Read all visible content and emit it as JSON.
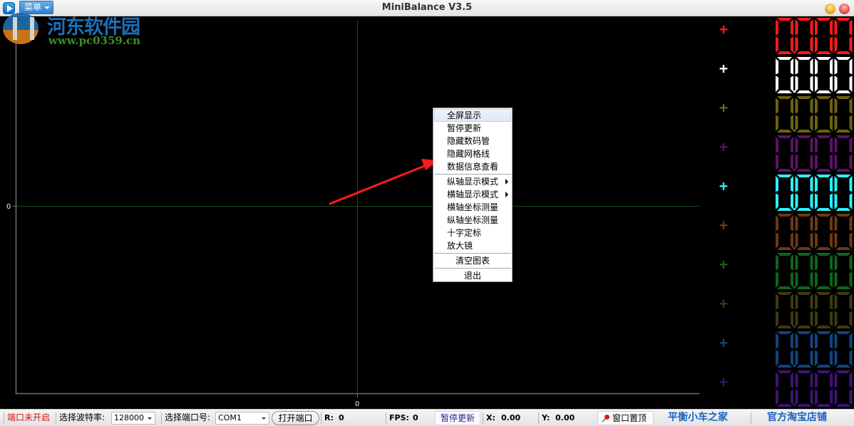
{
  "window": {
    "title": "MiniBalance V3.5",
    "menu_label": "菜单",
    "icons": {
      "app": "play-icon",
      "minimize": "minimize-icon",
      "close": "close-icon"
    }
  },
  "watermark": {
    "name": "河东软件园",
    "url": "www.pc0359.cn"
  },
  "plot": {
    "y_tick_label": "0",
    "x_tick_label": "0",
    "colors": {
      "background": "#000000",
      "axis": "#707070",
      "gridline": "#1f4a1f",
      "tick_text": "#e8f0ff"
    }
  },
  "annotation": {
    "type": "arrow",
    "color": "#ff1a1a",
    "points_to": "数据信息查看"
  },
  "context_menu": {
    "items": [
      {
        "label": "全屏显示",
        "highlighted": true
      },
      {
        "label": "暂停更新"
      },
      {
        "label": "隐藏数码管"
      },
      {
        "label": "隐藏网格线"
      },
      {
        "label": "数据信息查看"
      },
      {
        "separator": true
      },
      {
        "label": "纵轴显示模式",
        "submenu": true
      },
      {
        "label": "横轴显示模式",
        "submenu": true
      },
      {
        "label": "横轴坐标测量"
      },
      {
        "label": "纵轴坐标测量"
      },
      {
        "label": "十字定标"
      },
      {
        "label": "放大镜"
      },
      {
        "separator": true
      },
      {
        "label": "清空图表",
        "centered": true
      },
      {
        "separator": true
      },
      {
        "label": "退出",
        "centered": true
      }
    ]
  },
  "channels": [
    {
      "value": "0.000",
      "color": "#ff1a1a"
    },
    {
      "value": "0.000",
      "color": "#ffffff"
    },
    {
      "value": "0.000",
      "color": "#6b6310"
    },
    {
      "value": "0.000",
      "color": "#5e1266"
    },
    {
      "value": "0.000",
      "color": "#2af2ff"
    },
    {
      "value": "0.000",
      "color": "#6b3a14"
    },
    {
      "value": "0.000",
      "color": "#10641a"
    },
    {
      "value": "0.000",
      "color": "#3e3a10"
    },
    {
      "value": "0.000",
      "color": "#12447e"
    },
    {
      "value": "0.000",
      "color": "#3c1470"
    }
  ],
  "statusbar": {
    "port_status": "端口未开启",
    "baud_label": "选择波特率:",
    "baud_value": "128000",
    "port_label": "选择端口号:",
    "port_value": "COM1",
    "open_port_button": "打开端口",
    "r_label": "R:",
    "r_value": "0",
    "fps_label": "FPS:",
    "fps_value": "0",
    "pause_button": "暂停更新",
    "x_label": "X:",
    "x_value": "0.00",
    "y_label": "Y:",
    "y_value": "0.00",
    "pin_button": "窗口置顶",
    "link_home": "平衡小车之家",
    "link_shop": "官方淘宝店铺",
    "colors": {
      "port_status": "#e01010",
      "link": "#1a62c4"
    }
  }
}
